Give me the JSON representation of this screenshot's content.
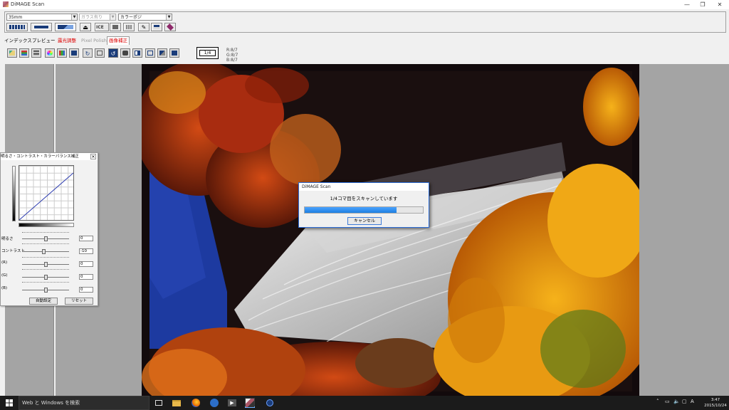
{
  "window": {
    "title": "DiMAGE Scan",
    "controls": [
      "—",
      "❐",
      "✕"
    ]
  },
  "toolbar": {
    "film_type": "35mm",
    "holder": "ガラス有り",
    "color_mode": "カラーポジ"
  },
  "tabs": [
    {
      "label": "インデックス"
    },
    {
      "label": "プレビュー"
    },
    {
      "label": "露光調整"
    },
    {
      "label": "Pixel Polish"
    },
    {
      "label": "画像補正"
    }
  ],
  "frame_counter": "1/4",
  "rgb_readout": [
    "R:8/7",
    "G:8/7",
    "B:8/7"
  ],
  "tone_panel": {
    "title": "明るさ・コントラスト・カラーバランス補正",
    "close": "✕",
    "sliders": [
      {
        "label": "明るさ",
        "value": "0",
        "level": 0.5
      },
      {
        "label": "コントラスト",
        "value": "-10",
        "level": 0.45
      },
      {
        "label": "(R)",
        "value": "0",
        "level": 0.5
      },
      {
        "label": "(G)",
        "value": "0",
        "level": 0.5
      },
      {
        "label": "(B)",
        "value": "0",
        "level": 0.5
      }
    ],
    "auto_button": "自動設定",
    "reset_button": "リセット"
  },
  "scan_dialog": {
    "title": "DiMAGE Scan",
    "message": "1/4コマ目をスキャンしています",
    "progress": 0.78,
    "cancel_button": "キャンセル"
  },
  "taskbar": {
    "search_placeholder": "Web と Windows を検索",
    "tray_input": "A",
    "time": "3:47",
    "date": "2015/10/24"
  },
  "colors": {
    "accent": "#2b6bd6",
    "progress": "#1e7fe0",
    "label_red": "#d00000"
  }
}
